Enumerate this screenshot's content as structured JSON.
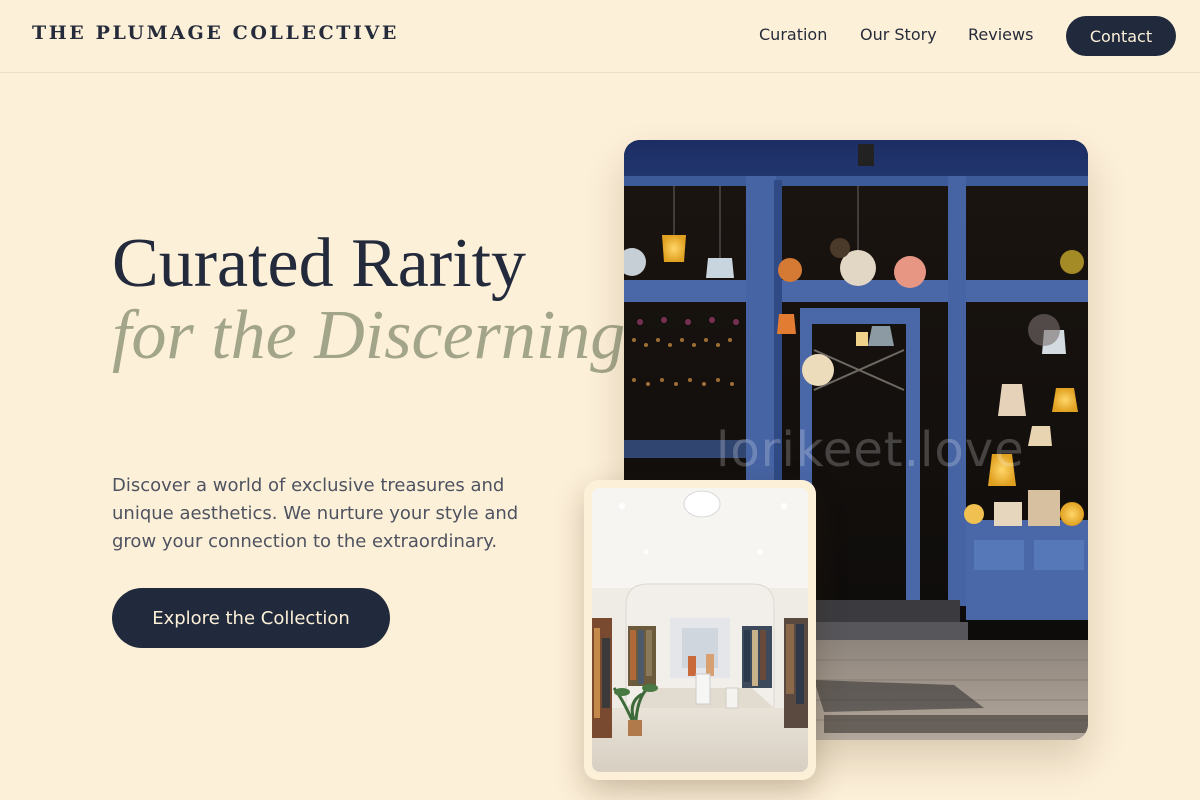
{
  "header": {
    "brand": "THE PLUMAGE COLLECTIVE",
    "nav": [
      {
        "label": "Curation"
      },
      {
        "label": "Our Story"
      },
      {
        "label": "Reviews"
      }
    ],
    "contact_label": "Contact"
  },
  "hero": {
    "title_line1": "Curated Rarity",
    "title_line2": "for the Discerning.",
    "description": "Discover a world of exclusive treasures and unique aesthetics. We nurture your style and grow your connection to the extraordinary.",
    "cta_label": "Explore the Collection"
  },
  "images": {
    "storefront_watermark": "lorikeet.love"
  },
  "colors": {
    "background": "#fdf0d8",
    "primary_dark": "#202a3c",
    "accent_sage": "#a3a58a",
    "body_text": "#4e5361"
  }
}
